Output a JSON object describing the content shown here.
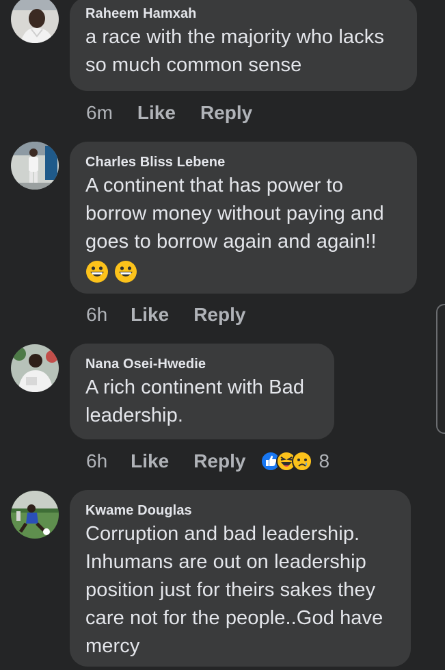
{
  "comments": [
    {
      "author": "Raheem Hamxah",
      "text": "a race with the majority who lacks so much common sense",
      "time": "6m",
      "like_label": "Like",
      "reply_label": "Reply"
    },
    {
      "author": "Charles Bliss Lebene",
      "text": "A continent that has power to borrow money without paying and goes to borrow again and again!!",
      "emojis": [
        "grinning-face",
        "grinning-face"
      ],
      "time": "6h",
      "like_label": "Like",
      "reply_label": "Reply"
    },
    {
      "author": "Nana Osei-Hwedie",
      "text": "A rich continent with Bad leadership.",
      "time": "6h",
      "like_label": "Like",
      "reply_label": "Reply",
      "reactions": [
        "like-reaction",
        "laugh-reaction",
        "sad-reaction"
      ],
      "reaction_count": "8"
    },
    {
      "author": "Kwame Douglas",
      "text": "Corruption and bad leadership. Inhumans are out on leadership position just for theirs sakes they care not for the people..God have mercy"
    }
  ],
  "colors": {
    "background": "#242526",
    "bubble": "#3a3b3c",
    "text": "#e4e6eb",
    "secondary_text": "#b0b3b8",
    "like_reaction": "#1877f2",
    "emoji_yellow": "#fcc21b"
  }
}
